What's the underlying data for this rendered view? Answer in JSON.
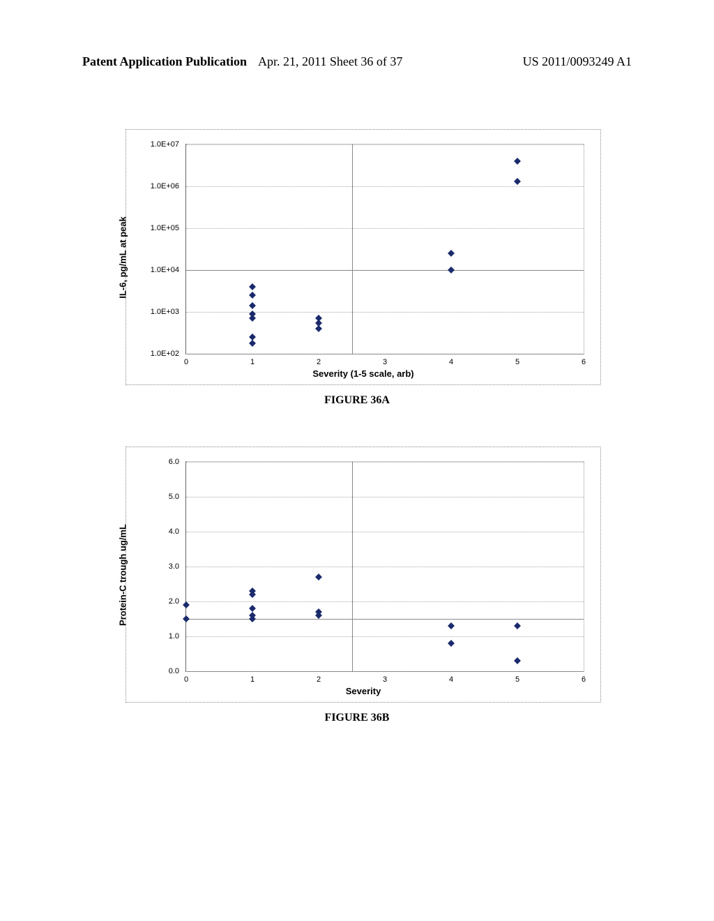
{
  "header": {
    "left": "Patent Application Publication",
    "center": "Apr. 21, 2011  Sheet 36 of 37",
    "right": "US 2011/0093249 A1"
  },
  "captions": {
    "a": "FIGURE 36A",
    "b": "FIGURE 36B"
  },
  "chartA": {
    "ylabel": "IL-6, pg/mL at peak",
    "xlabel": "Severity (1-5 scale, arb)",
    "yticks": [
      "1.0E+02",
      "1.0E+03",
      "1.0E+04",
      "1.0E+05",
      "1.0E+06",
      "1.0E+07"
    ],
    "xticks": [
      "0",
      "1",
      "2",
      "3",
      "4",
      "5",
      "6"
    ]
  },
  "chartB": {
    "ylabel": "Protein-C trough ug/mL",
    "xlabel": "Severity",
    "yticks": [
      "0.0",
      "1.0",
      "2.0",
      "3.0",
      "4.0",
      "5.0",
      "6.0"
    ],
    "xticks": [
      "0",
      "1",
      "2",
      "3",
      "4",
      "5",
      "6"
    ]
  },
  "chart_data": [
    {
      "type": "scatter",
      "title": "FIGURE 36A",
      "xlabel": "Severity (1-5 scale, arb)",
      "ylabel": "IL-6, pg/mL at peak",
      "x_range": [
        0,
        6
      ],
      "y_scale": "log",
      "y_range_exp": [
        2,
        7
      ],
      "grid": true,
      "ref_lines": {
        "horizontal": [
          10000
        ],
        "vertical": [
          2.5
        ]
      },
      "series": [
        {
          "name": "IL-6",
          "points": [
            {
              "x": 1,
              "y": 4000
            },
            {
              "x": 1,
              "y": 2500
            },
            {
              "x": 1,
              "y": 1400
            },
            {
              "x": 1,
              "y": 900
            },
            {
              "x": 1,
              "y": 700
            },
            {
              "x": 1,
              "y": 250
            },
            {
              "x": 1,
              "y": 180
            },
            {
              "x": 2,
              "y": 700
            },
            {
              "x": 2,
              "y": 550
            },
            {
              "x": 2,
              "y": 400
            },
            {
              "x": 4,
              "y": 25000
            },
            {
              "x": 4,
              "y": 10000
            },
            {
              "x": 5,
              "y": 4000000
            },
            {
              "x": 5,
              "y": 1300000
            }
          ]
        }
      ]
    },
    {
      "type": "scatter",
      "title": "FIGURE 36B",
      "xlabel": "Severity",
      "ylabel": "Protein-C trough ug/mL",
      "x_range": [
        0,
        6
      ],
      "y_scale": "linear",
      "y_range": [
        0,
        6
      ],
      "grid": true,
      "ref_lines": {
        "horizontal": [
          1.5
        ],
        "vertical": [
          2.5
        ]
      },
      "series": [
        {
          "name": "Protein-C",
          "points": [
            {
              "x": 0,
              "y": 1.9
            },
            {
              "x": 0,
              "y": 1.5
            },
            {
              "x": 1,
              "y": 2.3
            },
            {
              "x": 1,
              "y": 2.2
            },
            {
              "x": 1,
              "y": 1.8
            },
            {
              "x": 1,
              "y": 1.6
            },
            {
              "x": 1,
              "y": 1.5
            },
            {
              "x": 2,
              "y": 2.7
            },
            {
              "x": 2,
              "y": 1.7
            },
            {
              "x": 2,
              "y": 1.6
            },
            {
              "x": 4,
              "y": 1.3
            },
            {
              "x": 4,
              "y": 0.8
            },
            {
              "x": 5,
              "y": 1.3
            },
            {
              "x": 5,
              "y": 0.3
            }
          ]
        }
      ]
    }
  ]
}
